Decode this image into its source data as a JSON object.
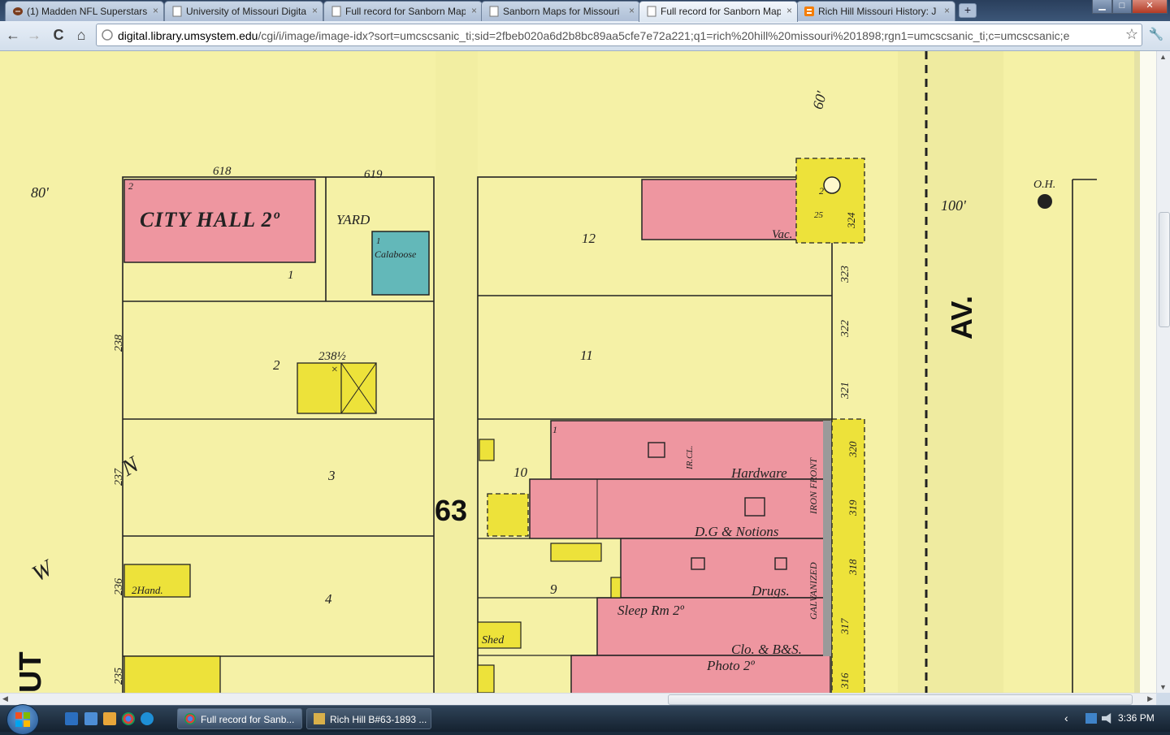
{
  "tabs": [
    {
      "title": "(1) Madden NFL Superstars",
      "close": "×"
    },
    {
      "title": "University of Missouri Digital",
      "close": "×"
    },
    {
      "title": "Full record for Sanborn Map",
      "close": "×"
    },
    {
      "title": "Sanborn Maps for Missouri",
      "close": "×"
    },
    {
      "title": "Full record for Sanborn Map",
      "close": "×"
    },
    {
      "title": "Rich Hill Missouri History: J",
      "close": "×"
    }
  ],
  "new_tab": "+",
  "window_controls": {
    "minimize": "▁",
    "maximize": "□",
    "close": "✕"
  },
  "toolbar": {
    "back": "←",
    "forward": "→",
    "reload": "C",
    "home": "⌂",
    "star": "☆",
    "wrench": "🔧"
  },
  "address": {
    "domain": "digital.library.umsystem.edu",
    "path": "/cgi/i/image/image-idx?sort=umcscsanic_ti;sid=2fbeb020a6d2b8bc89aa5cfe7e72a221;q1=rich%20hill%20missouri%201898;rgn1=umcscsanic_ti;c=umcscsanic;e"
  },
  "map": {
    "labels": {
      "city_hall": "CITY HALL 2º",
      "yard": "YARD",
      "calaboose": "Calaboose",
      "block_number": "63",
      "hardware": "Hardware",
      "dg_notions": "D.G & Notions",
      "drugs": "Drugs.",
      "sleep_rm": "Sleep Rm 2º",
      "clo_bs": "Clo. & B&S.",
      "photo": "Photo 2º",
      "vac": "Vac.",
      "av": "AV.",
      "oh": "O.H.",
      "shed": "Shed",
      "two_hand": "2Hand.",
      "iron_front": "IRON FRONT",
      "galvanized": "GALVANIZED",
      "ircl": "IR.CL.",
      "n": "N",
      "w": "W",
      "ut": "UT"
    },
    "dimensions": {
      "d80": "80'",
      "d60": "60'",
      "d100": "100'"
    },
    "addresses": {
      "a618": "618",
      "a619": "619",
      "a238": "238",
      "a238h": "238½",
      "a237": "237",
      "a236": "236",
      "a235": "235",
      "a324": "324",
      "a323": "323",
      "a322": "322",
      "a321": "321",
      "a320": "320",
      "a319": "319",
      "a318": "318",
      "a317": "317",
      "a316": "316"
    },
    "lots": {
      "l1": "1",
      "l2": "2",
      "l3": "3",
      "l4": "4",
      "l9": "9",
      "l10": "10",
      "l11": "11",
      "l12": "12"
    },
    "small": {
      "s2": "2",
      "s1": "1",
      "s25": "25",
      "x": "×"
    },
    "colors": {
      "paper": "#f5f1a6",
      "brick": "#ee96a0",
      "frame": "#ede23a",
      "stone": "#63b8b9",
      "ink": "#1c1c1c"
    }
  },
  "taskbar": {
    "tasks": [
      {
        "title": "Full record for Sanb..."
      },
      {
        "title": "Rich Hill B#63-1893 ..."
      }
    ],
    "clock": "3:36 PM",
    "tray_arrow": "‹"
  }
}
